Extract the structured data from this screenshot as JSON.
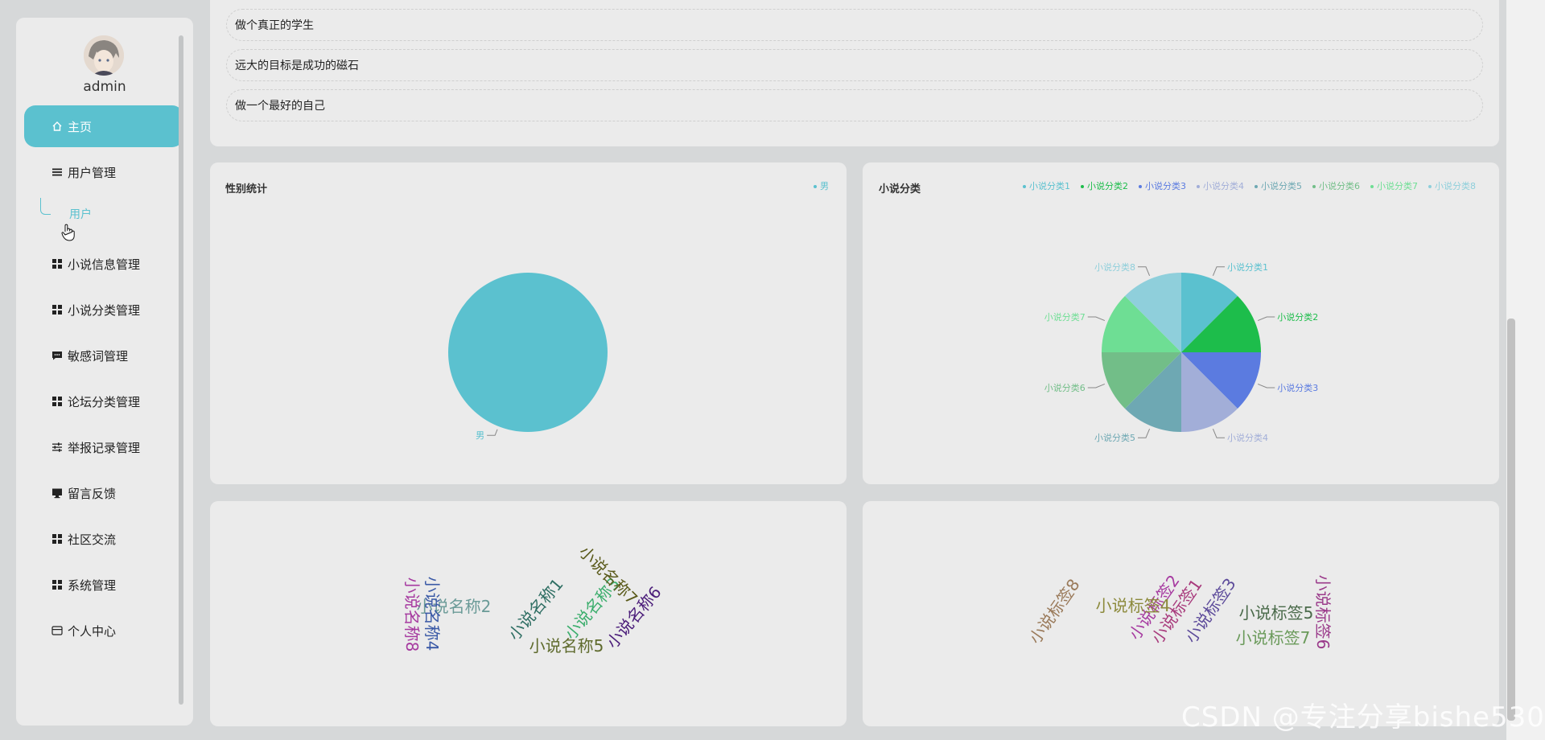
{
  "user": {
    "name": "admin"
  },
  "menu": [
    {
      "label": "主页",
      "icon": "home-icon",
      "active": true
    },
    {
      "label": "用户管理",
      "icon": "list-icon"
    },
    {
      "label": "小说信息管理",
      "icon": "grid-icon"
    },
    {
      "label": "小说分类管理",
      "icon": "grid-icon"
    },
    {
      "label": "敏感词管理",
      "icon": "chat-icon"
    },
    {
      "label": "论坛分类管理",
      "icon": "grid-icon"
    },
    {
      "label": "举报记录管理",
      "icon": "sliders-icon"
    },
    {
      "label": "留言反馈",
      "icon": "monitor-icon"
    },
    {
      "label": "社区交流",
      "icon": "grid-icon"
    },
    {
      "label": "系统管理",
      "icon": "grid-icon"
    },
    {
      "label": "个人中心",
      "icon": "card-icon"
    }
  ],
  "submenu": {
    "label": "用户"
  },
  "quotes": [
    "做个真正的学生",
    "远大的目标是成功的磁石",
    "做一个最好的自己"
  ],
  "colors": {
    "accent": "#5bc1cf"
  },
  "chart_data": [
    {
      "type": "pie",
      "title": "性别统计",
      "legend_position": "top-right",
      "categories": [
        "男"
      ],
      "values": [
        1
      ],
      "colors": [
        "#5bc1cf"
      ]
    },
    {
      "type": "pie",
      "title": "小说分类",
      "legend_position": "top-right",
      "categories": [
        "小说分类1",
        "小说分类2",
        "小说分类3",
        "小说分类4",
        "小说分类5",
        "小说分类6",
        "小说分类7",
        "小说分类8"
      ],
      "values": [
        1,
        1,
        1,
        1,
        1,
        1,
        1,
        1
      ],
      "colors": [
        "#5bc1cf",
        "#1dbd4b",
        "#5b7be0",
        "#a2aed8",
        "#6ea8b3",
        "#72be88",
        "#6ede94",
        "#8fcfdb"
      ]
    },
    {
      "type": "wordcloud",
      "words": [
        {
          "text": "小说名称1",
          "color": "#2e6e63"
        },
        {
          "text": "小说名称2",
          "color": "#6a9a97"
        },
        {
          "text": "小说名称3",
          "color": "#3cae6d"
        },
        {
          "text": "小说名称4",
          "color": "#3a59a6"
        },
        {
          "text": "小说名称5",
          "color": "#5e6a2c"
        },
        {
          "text": "小说名称6",
          "color": "#4b1d7a"
        },
        {
          "text": "小说名称7",
          "color": "#5a5a1a"
        },
        {
          "text": "小说名称8",
          "color": "#a63aa0"
        }
      ]
    },
    {
      "type": "wordcloud",
      "words": [
        {
          "text": "小说标签1",
          "color": "#a83a7c"
        },
        {
          "text": "小说标签2",
          "color": "#a63aa0"
        },
        {
          "text": "小说标签3",
          "color": "#5c4a9a"
        },
        {
          "text": "小说标签4",
          "color": "#8c8a3c"
        },
        {
          "text": "小说标签5",
          "color": "#4a6a4a"
        },
        {
          "text": "小说标签6",
          "color": "#9a3a8a"
        },
        {
          "text": "小说标签7",
          "color": "#6a9a5a"
        },
        {
          "text": "小说标签8",
          "color": "#9a7a5a"
        }
      ]
    }
  ],
  "watermark": "CSDN @专注分享bishe530"
}
